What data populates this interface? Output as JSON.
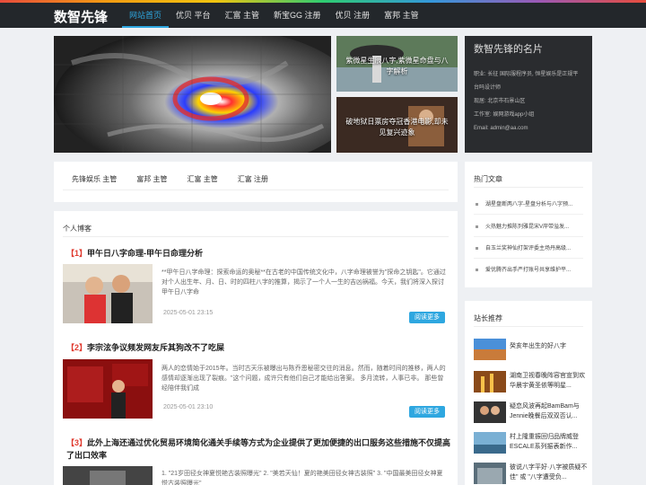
{
  "header": {
    "logo": "数智先锋",
    "nav": [
      "网站首页",
      "优贝 平台",
      "汇富 主管",
      "新宝GG 注册",
      "优贝 注册",
      "富邦 主管"
    ]
  },
  "hero": {
    "side_top_caption": "紫微星生辰八字,紫微星命盘与八字解析",
    "side_bottom_caption": "破地狱日票房夺冠香港电影,却未见复兴迹象"
  },
  "profile_card": {
    "title": "数智先锋的名片",
    "rows": [
      "职业: 长征 国际服程序员, 恒星娱乐是正规平台吗设计师",
      "现居: 北京市石景山区",
      "工作室: 娱网游戏app小组",
      "Email: admin@aa.com"
    ]
  },
  "tabs": [
    "先锋娱乐 主管",
    "富邦 主管",
    "汇富 主管",
    "汇富 注册"
  ],
  "blog": {
    "section_title": "个人博客",
    "posts": [
      {
        "num": "【1】",
        "title": "甲午日八字命理-甲午日命理分析",
        "excerpt": "**甲午日八字命理：探索命运的奥秘**在古老的中国传统文化中，八字命理被誉为\"探命之钥匙\"。它通过对个人出生年、月、日、时的四柱八字的推算，揭示了一个人一生的吉凶祸福。今天，我们将深入探讨甲午日八字命",
        "date": "2025-05-01 23:15",
        "more": "阅读更多"
      },
      {
        "num": "【2】",
        "title": "李宗泫争议频发网友斥其狗改不了吃屎",
        "excerpt": "两人的恋情始于2015年。当时古天乐被曝出与陈乔恩秘密交往的消息。然而，随着时间的推移，两人的感情却逐渐出现了裂痕。\"这个问题，成许只有他们自己才能给出答案。 多月流转，人事已非。 那些曾经陪伴我们成",
        "date": "2025-05-01 23:10",
        "more": "阅读更多"
      },
      {
        "num": "【3】",
        "title": "此外上海还通过优化贸易环境简化通关手续等方式为企业提供了更加便捷的出口服务这些措施不仅提高了出口效率",
        "excerpt": "1. \"21岁田径女神夏悦艳古装照曝光\" 2. \"美若天仙！夏的艳美田径女神古装照\" 3. \"中国最美田径女神夏悦古装照曝光\""
      }
    ]
  },
  "hot": {
    "title": "热门文章",
    "items": [
      "湖星盘断两八字-星盘分析与八字预...",
      "火热魅力推陈列雅昆宋V岸带溢发...",
      "自玉兰奖神仙打架评委主场丹高级...",
      "爱优腾齐出手严打账号共享维护平..."
    ]
  },
  "rec": {
    "title": "站长推荐",
    "items": [
      "癸亥年出生的好八字",
      "湖南卫视春晚阵容官宣到欢华晨宇黄圣依等明星...",
      "疑恋风波再起BamBam与Jennie晚餐后双双否认...",
      "村上隆重振回归品牌威登ESCALE系列振表新作...",
      "彼说八字平好·八字被质疑不佳\" 或 \"八字遭受负..."
    ]
  }
}
